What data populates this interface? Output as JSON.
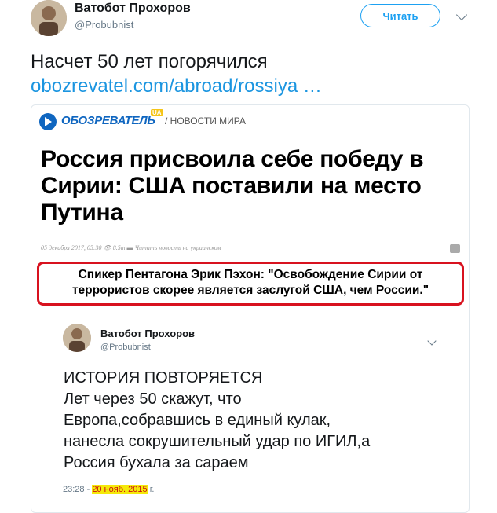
{
  "tweet": {
    "author_name": "Ватобот Прохоров",
    "author_handle": "@Probubnist",
    "follow_label": "Читать",
    "text": "Насчет 50 лет погорячился",
    "link": "obozrevatel.com/abroad/rossiya  …"
  },
  "card": {
    "logo_text": "ОБОЗРЕВАТЕЛЬ",
    "logo_badge": "UA",
    "section": "/ НОВОСТИ МИРА",
    "headline": "Россия присвоила себе победу в Сирии: США поставили на место Путина",
    "meta": "05 декабря 2017, 05:30  👁 8.5т  ▬ Читать новость на украинском",
    "quote": "Спикер Пентагона Эрик Пэхон: \"Освобождение Сирии от террористов скорее является заслугой США, чем России.\""
  },
  "embedded_tweet": {
    "author_name": "Ватобот Прохоров",
    "author_handle": "@Probubnist",
    "lines": [
      "ИСТОРИЯ ПОВТОРЯЕТСЯ",
      "Лет через 50 скажут, что",
      "Европа,собравшись в единый кулак,",
      "нанесла сокрушительный удар по ИГИЛ,а",
      "Россия бухала за сараем"
    ],
    "time": "23:28 -",
    "date": "20 нояб. 2015",
    "date_suffix": "г."
  },
  "colors": {
    "link": "#1b95e0",
    "highlight": "#f5e90a",
    "quote_border": "#d8121f",
    "brand": "#0f66c0"
  },
  "icons": [
    "avatar",
    "chevron-down-icon",
    "obozrevatel-logo-icon",
    "printer-icon"
  ]
}
